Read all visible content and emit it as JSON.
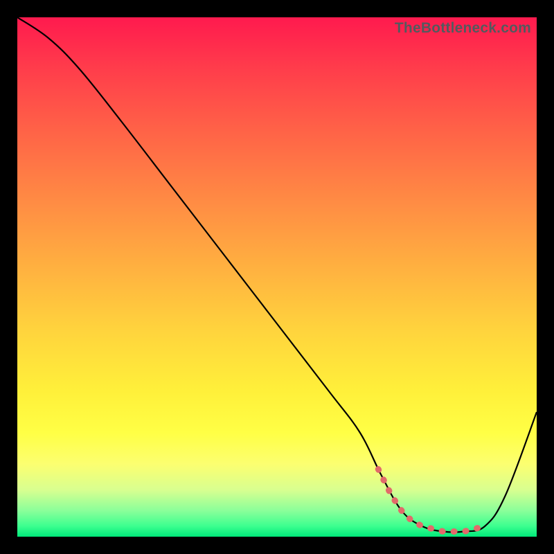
{
  "watermark": "TheBottleneck.com",
  "chart_data": {
    "type": "line",
    "title": "",
    "xlabel": "",
    "ylabel": "",
    "xlim": [
      0,
      100
    ],
    "ylim": [
      0,
      100
    ],
    "series": [
      {
        "name": "curve",
        "color": "#000000",
        "x": [
          0,
          6,
          12,
          20,
          30,
          40,
          50,
          60,
          66,
          70,
          74,
          78,
          82,
          86,
          90,
          94,
          100
        ],
        "values": [
          100,
          96,
          90,
          80,
          67,
          54,
          41,
          28,
          20,
          12,
          5,
          2,
          1,
          1,
          2,
          8,
          24
        ]
      }
    ],
    "highlight": {
      "name": "valley-markers",
      "color": "#e26a6a",
      "x": [
        69.5,
        72,
        74,
        76,
        78,
        80,
        82,
        84,
        86,
        88,
        90
      ],
      "values": [
        13,
        8,
        5,
        3,
        2,
        1.5,
        1,
        1,
        1,
        1.5,
        2
      ]
    }
  }
}
